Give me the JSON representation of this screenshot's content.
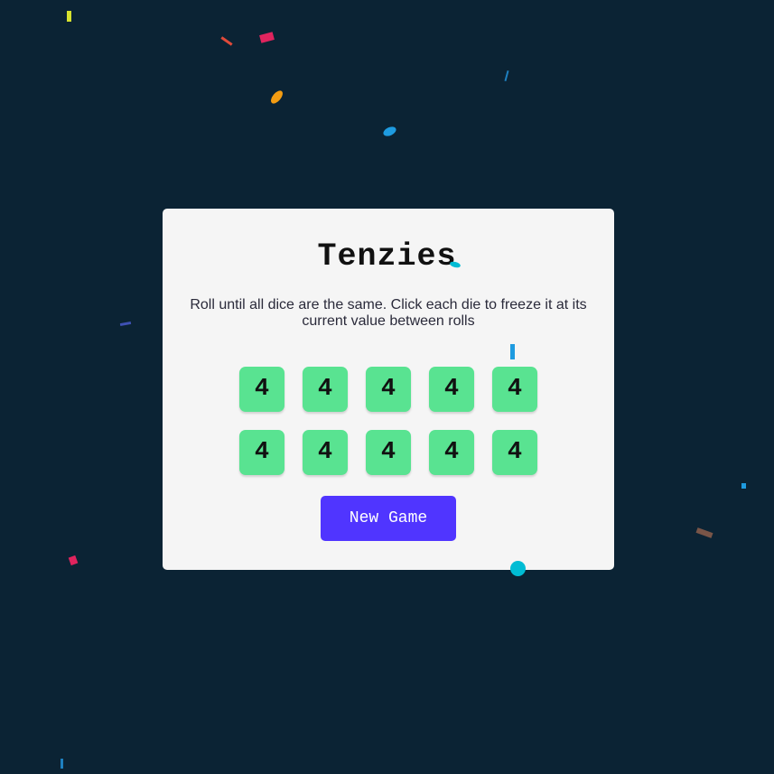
{
  "app": {
    "title": "Tenzies",
    "instructions": "Roll until all dice are the same. Click each die to freeze it at its current value between rolls"
  },
  "dice": [
    {
      "value": "4",
      "held": true
    },
    {
      "value": "4",
      "held": true
    },
    {
      "value": "4",
      "held": true
    },
    {
      "value": "4",
      "held": true
    },
    {
      "value": "4",
      "held": true
    },
    {
      "value": "4",
      "held": true
    },
    {
      "value": "4",
      "held": true
    },
    {
      "value": "4",
      "held": true
    },
    {
      "value": "4",
      "held": true
    },
    {
      "value": "4",
      "held": true
    }
  ],
  "controls": {
    "new_game_label": "New Game"
  },
  "colors": {
    "background": "#0b2334",
    "card": "#f5f5f5",
    "die_held": "#59e391",
    "button": "#5035ff",
    "confetti": [
      "#d6e12e",
      "#e0245e",
      "#f39c12",
      "#1e9be0",
      "#00bcd4",
      "#795548",
      "#3f51b5"
    ]
  }
}
